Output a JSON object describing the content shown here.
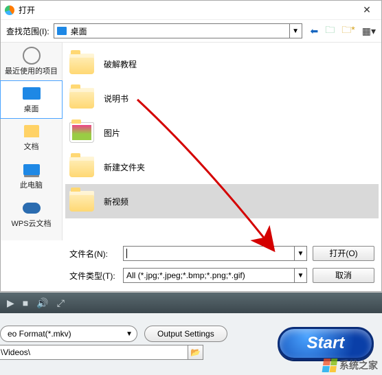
{
  "dialog": {
    "title": "打开",
    "lookin_label": "查找范围(I):",
    "lookin_value": "桌面",
    "filename_label": "文件名(N):",
    "filename_value": "",
    "filetype_label": "文件类型(T):",
    "filetype_value": "All (*.jpg;*.jpeg;*.bmp;*.png;*.gif)",
    "open_btn": "打开(O)",
    "cancel_btn": "取消"
  },
  "sidebar": {
    "items": [
      {
        "label": "最近使用的项目"
      },
      {
        "label": "桌面"
      },
      {
        "label": "文档"
      },
      {
        "label": "此电脑"
      },
      {
        "label": "WPS云文档"
      }
    ]
  },
  "files": [
    {
      "name": "破解教程",
      "kind": "folder"
    },
    {
      "name": "说明书",
      "kind": "folder"
    },
    {
      "name": "图片",
      "kind": "photo"
    },
    {
      "name": "新建文件夹",
      "kind": "folder"
    },
    {
      "name": "新视频",
      "kind": "folder",
      "selected": true
    }
  ],
  "bg": {
    "format_value": "eo Format(*.mkv)",
    "output_settings": "Output Settings",
    "start": "Start",
    "path_value": "\\Videos\\"
  },
  "watermark": "系统之家"
}
